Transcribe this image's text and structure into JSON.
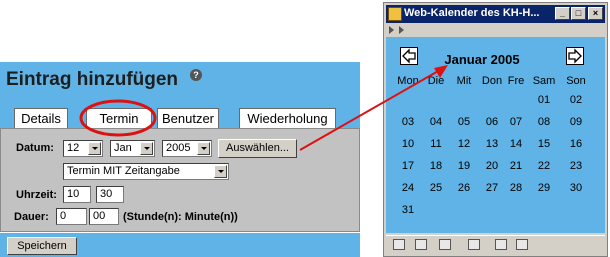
{
  "form": {
    "title": "Eintrag hinzufügen",
    "help_glyph": "?",
    "tabs": [
      "Details",
      "Termin",
      "Benutzer",
      "Wiederholung"
    ],
    "datum_label": "Datum:",
    "day_value": "12",
    "month_value": "Jan",
    "year_value": "2005",
    "choose_button": "Auswählen...",
    "mode_value": "Termin MIT Zeitangabe",
    "uhrzeit_label": "Uhrzeit:",
    "hour_value": "10",
    "minute_value": "30",
    "dauer_label": "Dauer:",
    "duration_hours": "0",
    "duration_minutes": "00",
    "duration_hint": "(Stunde(n): Minute(n))",
    "save_button": "Speichern"
  },
  "calendar_window": {
    "title": "Web-Kalender des KH-H...",
    "month_title": "Januar 2005",
    "weekdays": [
      "Mon",
      "Die",
      "Mit",
      "Don",
      "Fre",
      "Sam",
      "Son"
    ],
    "weeks": [
      [
        "",
        "",
        "",
        "",
        "",
        "01",
        "02"
      ],
      [
        "03",
        "04",
        "05",
        "06",
        "07",
        "08",
        "09"
      ],
      [
        "10",
        "11",
        "12",
        "13",
        "14",
        "15",
        "16"
      ],
      [
        "17",
        "18",
        "19",
        "20",
        "21",
        "22",
        "23"
      ],
      [
        "24",
        "25",
        "26",
        "27",
        "28",
        "29",
        "30"
      ],
      [
        "31",
        "",
        "",
        "",
        "",
        "",
        ""
      ]
    ]
  },
  "colors": {
    "panel_blue": "#5fb3e6",
    "form_gray": "#c2c2c2",
    "annotation_red": "#dd1111",
    "titlebar_navy": "#0a246a"
  }
}
